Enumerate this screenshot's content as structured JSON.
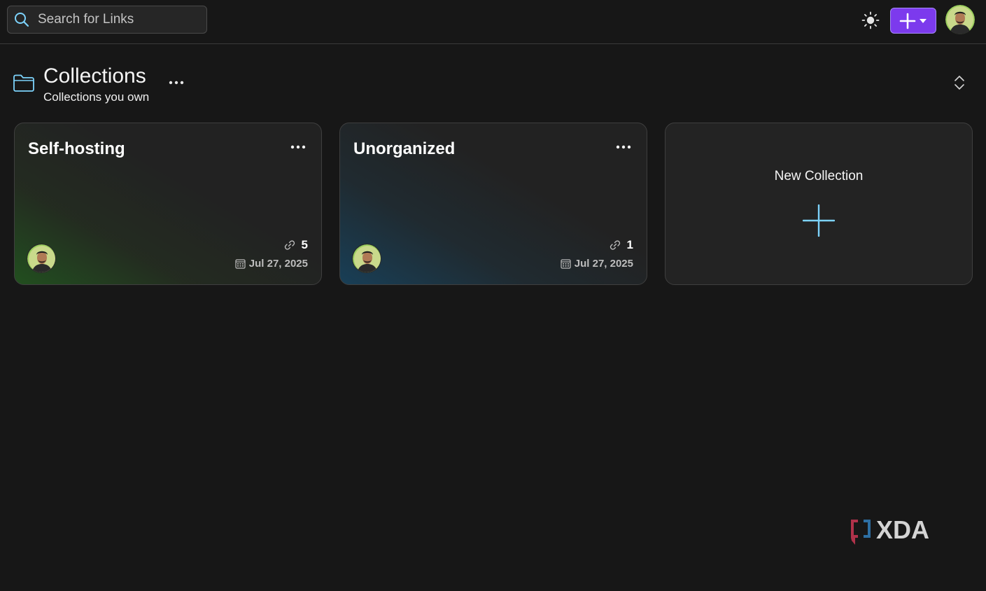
{
  "search": {
    "placeholder": "Search for Links"
  },
  "header": {
    "theme_icon": "sun-icon",
    "add_button_icons": [
      "plus-icon",
      "caret-down-icon"
    ],
    "accent_color": "#7c3aed"
  },
  "section": {
    "title": "Collections",
    "subtitle": "Collections you own",
    "icon": "folder-icon",
    "icon_color": "#7dd3fc"
  },
  "collections": [
    {
      "name": "Self-hosting",
      "link_count": "5",
      "date": "Jul 27, 2025",
      "accent_color": "#22c55e"
    },
    {
      "name": "Unorganized",
      "link_count": "1",
      "date": "Jul 27, 2025",
      "accent_color": "#0ea5e9"
    }
  ],
  "new_collection": {
    "label": "New Collection",
    "icon": "plus-icon",
    "icon_color": "#7dd3fc"
  },
  "watermark": {
    "text": "XDA"
  }
}
